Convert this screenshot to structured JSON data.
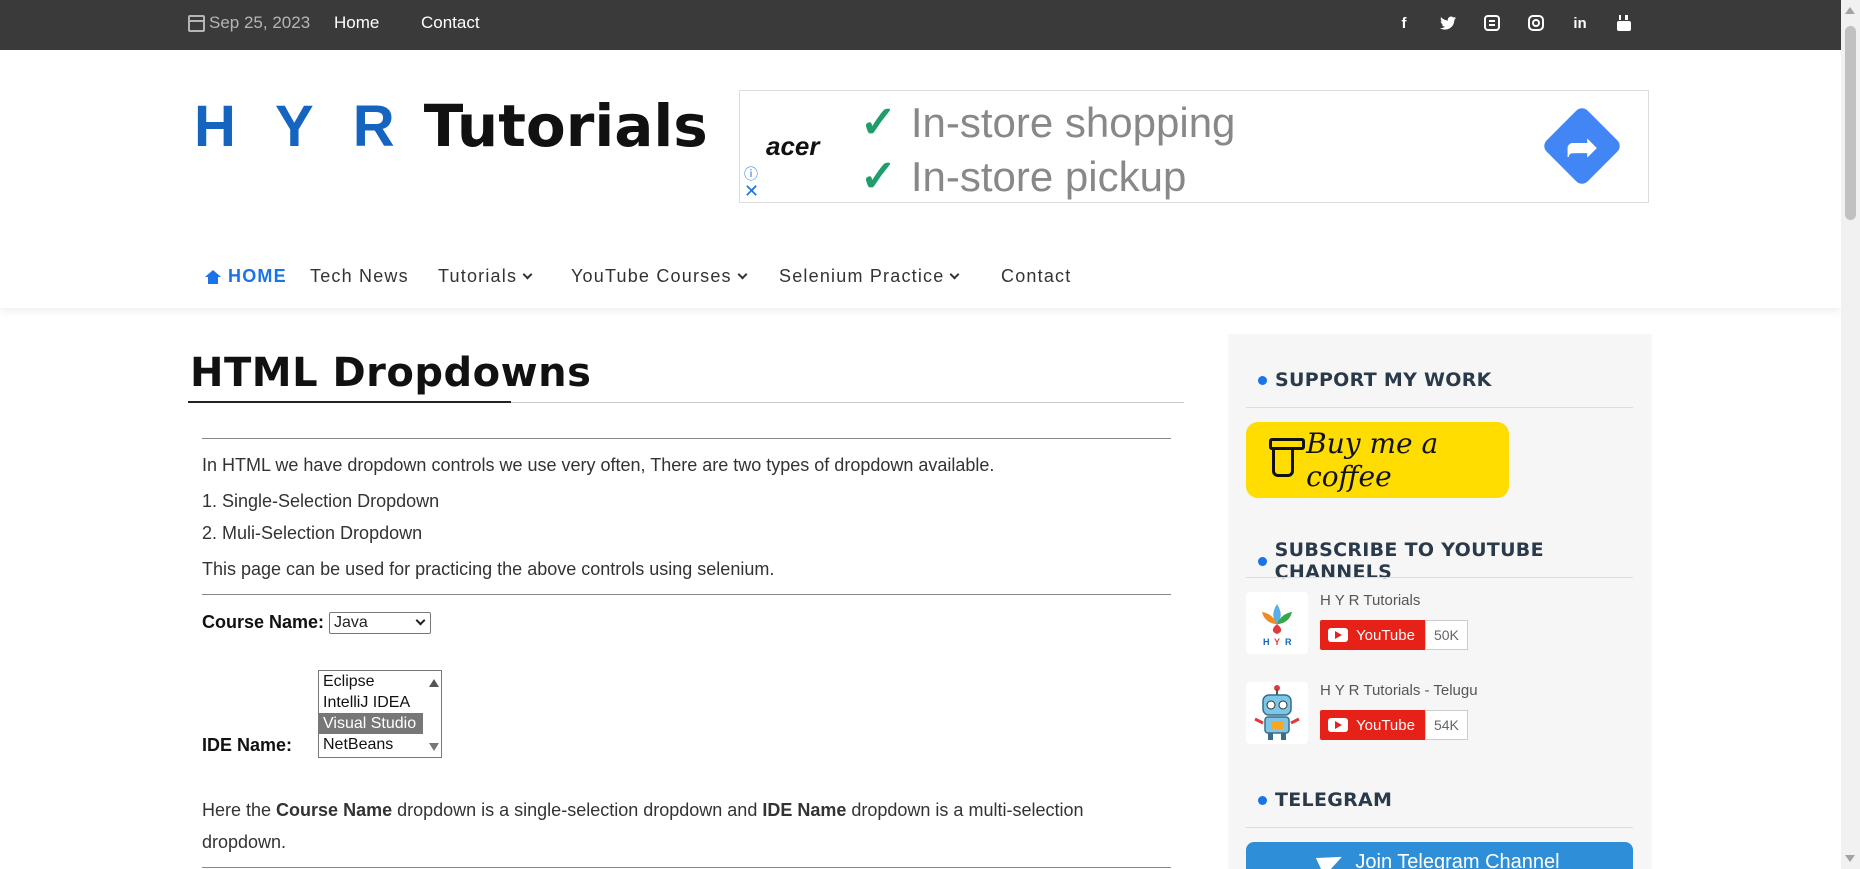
{
  "topbar": {
    "date": "Sep 25, 2023",
    "links": [
      "Home",
      "Contact"
    ],
    "social_icons": [
      "facebook-icon",
      "twitter-icon",
      "blogger-icon",
      "instagram-icon",
      "linkedin-icon",
      "youtube-icon"
    ]
  },
  "logo": {
    "part1": "H Y R",
    "part2": "Tutorials"
  },
  "ad": {
    "brand": "acer",
    "lines": [
      "In-store shopping",
      "In-store pickup"
    ]
  },
  "nav": {
    "items": [
      {
        "label": "HOME",
        "active": true,
        "dropdown": false
      },
      {
        "label": "Tech News",
        "dropdown": false
      },
      {
        "label": "Tutorials",
        "dropdown": true
      },
      {
        "label": "YouTube Courses",
        "dropdown": true
      },
      {
        "label": "Selenium Practice",
        "dropdown": true
      },
      {
        "label": "Contact",
        "dropdown": false
      }
    ]
  },
  "content": {
    "title": "HTML Dropdowns",
    "intro": "In HTML we have dropdown controls we use very often, There are two types of dropdown available.",
    "item1": "1. Single-Selection Dropdown",
    "item2": "2. Muli-Selection Dropdown",
    "practice": "This page can be used for practicing the above controls using selenium.",
    "course_label": "Course Name:",
    "course_value": "Java",
    "ide_label": "IDE Name:",
    "ide_options": [
      {
        "label": "Eclipse",
        "selected": false
      },
      {
        "label": "IntelliJ IDEA",
        "selected": false
      },
      {
        "label": "Visual Studio",
        "selected": true
      },
      {
        "label": "NetBeans",
        "selected": false
      }
    ],
    "explain_pre": "Here the ",
    "explain_b1": "Course Name",
    "explain_mid": " dropdown is a single-selection dropdown and ",
    "explain_b2": "IDE Name",
    "explain_post": " dropdown is a multi-selection",
    "explain_tail": "dropdown."
  },
  "sidebar": {
    "support_heading": "SUPPORT MY WORK",
    "coffee_label": "Buy me a coffee",
    "subscribe_heading": "SUBSCRIBE TO YOUTUBE CHANNELS",
    "channels": [
      {
        "name": "H Y R Tutorials",
        "button": "YouTube",
        "count": "50K"
      },
      {
        "name": "H Y R Tutorials - Telugu",
        "button": "YouTube",
        "count": "54K"
      }
    ],
    "telegram_heading": "TELEGRAM",
    "telegram_button": "Join Telegram Channel"
  },
  "colors": {
    "accent": "#1a73e8",
    "topbar": "#3a3a3a",
    "coffee": "#ffdd00",
    "youtube": "#e62117"
  }
}
